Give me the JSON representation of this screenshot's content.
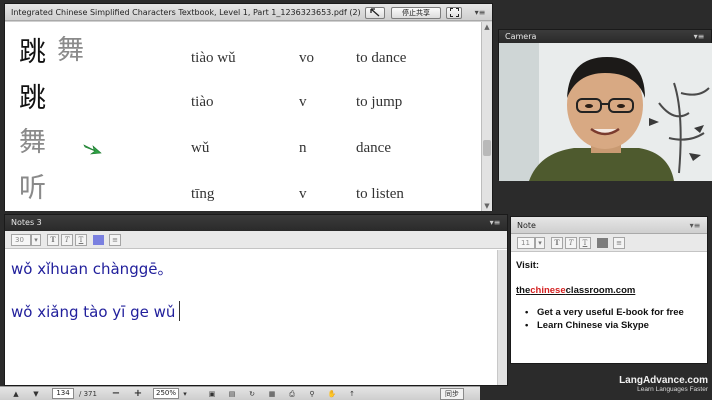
{
  "pdf_panel": {
    "title": "Integrated Chinese Simplified Characters Textbook, Level 1, Part 1_1236323653.pdf (2)",
    "stop_share_label": "停止共享",
    "vocab": [
      {
        "chars": "跳",
        "ghost": "舞",
        "pinyin": "tiào wǔ",
        "pos": "vo",
        "english": "to dance"
      },
      {
        "chars": "跳",
        "ghost": "",
        "pinyin": "tiào",
        "pos": "v",
        "english": "to jump"
      },
      {
        "chars": "",
        "ghost_left": "舞",
        "pinyin": "wǔ",
        "pos": "n",
        "english": "dance"
      },
      {
        "chars": "",
        "ghost_left": "听",
        "pinyin": "tīng",
        "pos": "v",
        "english": "to listen"
      }
    ]
  },
  "camera_panel": {
    "title": "Camera"
  },
  "notes_panel": {
    "title": "Notes 3",
    "font_size": "30",
    "lines": [
      "wǒ xǐhuan chànggē。",
      "wǒ xiǎng tào yī ge wǔ"
    ]
  },
  "note_panel": {
    "title": "Note",
    "font_size": "11",
    "visit": "Visit:",
    "link_pre": "the",
    "link_mid": "chinese",
    "link_post": "classroom.com",
    "bullets": [
      "Get a very useful E-book for free",
      "Learn Chinese via Skype"
    ]
  },
  "bottom_bar": {
    "page_current": "134",
    "page_total": "/ 371",
    "zoom": "250%",
    "sync_label": "同步"
  },
  "branding": {
    "name": "LangAdvance.com",
    "tagline": "Learn Languages Faster"
  },
  "colors": {
    "accent_blue": "#22209c",
    "link_red": "#d42222",
    "arrow_green": "#2ea043"
  },
  "icons": [
    "menu-icon",
    "pointer-icon",
    "fullscreen-icon",
    "arrow-up-icon",
    "arrow-down-icon",
    "zoom-out-icon",
    "zoom-in-icon",
    "green-arrow-pointer"
  ]
}
